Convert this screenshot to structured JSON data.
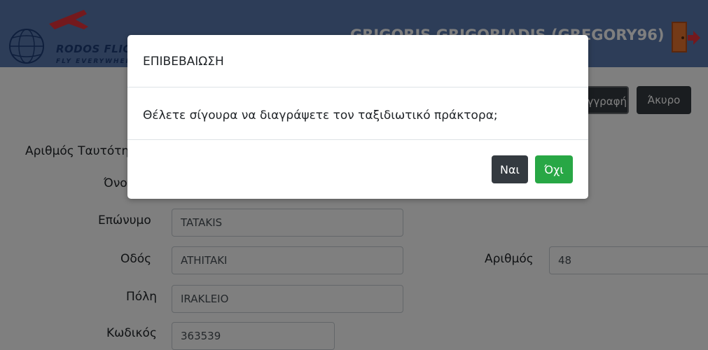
{
  "header": {
    "logo_name": "RODOS FLIGHTS",
    "logo_slogan": "FLY EVERYWHERE",
    "user": "GRIGORIS GRIGORIADIS (GREGORY96)"
  },
  "toolbar": {
    "save_label": "Εγγραφή",
    "cancel_label": "Άκυρο"
  },
  "form": {
    "id_label": "Αριθμός Ταυτότητας",
    "name_label": "Όνομα",
    "surname_label": "Επώνυμο",
    "surname_value": "TATAKIS",
    "street_label": "Οδός",
    "street_value": "ATHITAKI",
    "number_label": "Αριθμός",
    "number_value": "48",
    "city_label": "Πόλη",
    "city_value": "IRAKLEIO",
    "zip_label": "Κωδικός",
    "zip_value": "363539"
  },
  "modal": {
    "title": "ΕΠΙΒΕΒΑΙΩΣΗ",
    "message": "Θέλετε σίγουρα να διαγράψετε τον ταξιδιωτικό πράκτορα;",
    "yes_label": "Ναι",
    "no_label": "Όχι"
  },
  "colors": {
    "header_bg": "#5b7bb0",
    "dark_button": "#343a40",
    "success_button": "#28a745",
    "logo_plane": "#e8333b",
    "exit_door": "#e8752e"
  },
  "icons": [
    "globe-plane-logo-icon",
    "exit-door-icon"
  ]
}
